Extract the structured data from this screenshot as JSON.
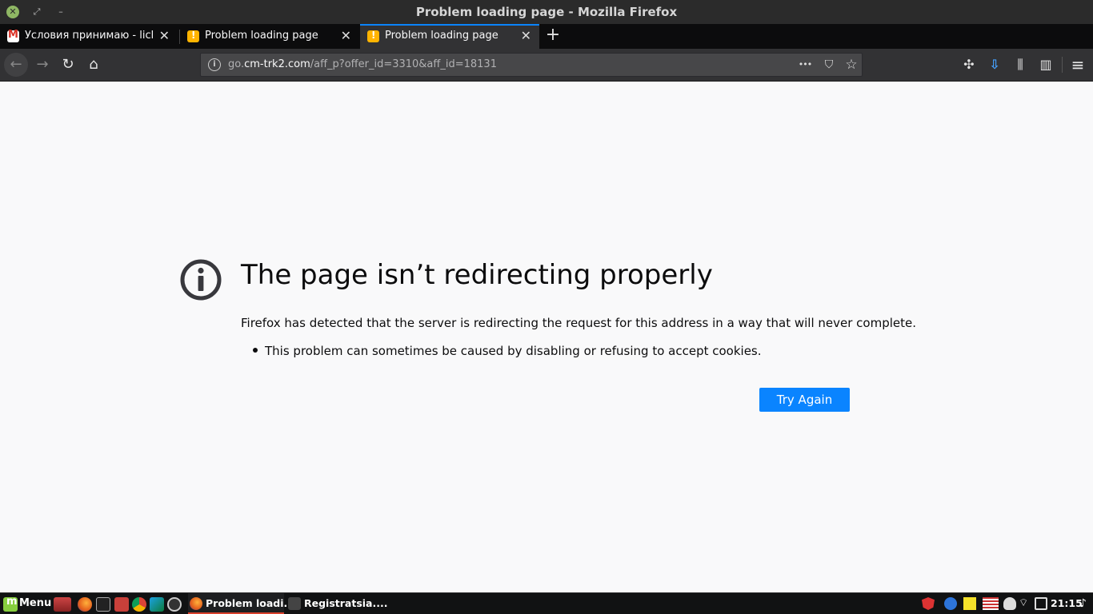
{
  "window": {
    "title": "Problem loading page - Mozilla Firefox",
    "close_glyph": "✕",
    "maximize_glyph": "⤢",
    "minimize_glyph": "–"
  },
  "tabs": [
    {
      "label": "Условия принимаю - lich.r",
      "favicon": "gmail-icon",
      "active": false
    },
    {
      "label": "Problem loading page",
      "favicon": "warning-icon",
      "active": false
    },
    {
      "label": "Problem loading page",
      "favicon": "warning-icon",
      "active": true
    }
  ],
  "tab_close_glyph": "✕",
  "new_tab_glyph": "+",
  "nav": {
    "back_glyph": "←",
    "forward_glyph": "→",
    "reload_glyph": "↻",
    "home_glyph": "⌂",
    "url_prefix": "go.",
    "url_host": "cm-trk2.com",
    "url_path": "/aff_p?offer_id=3310&aff_id=18131",
    "page_actions_glyph": "•••",
    "pocket_glyph": "⛉",
    "bookmark_glyph": "☆",
    "extensions_glyph": "✣",
    "downloads_glyph": "⇩",
    "library_glyph": "⫼",
    "sidebar_glyph": "▥",
    "menu_glyph": "≡"
  },
  "error": {
    "title": "The page isn’t redirecting properly",
    "description": "Firefox has detected that the server is redirecting the request for this address in a way that will never complete.",
    "items": [
      "This problem can sometimes be caused by disabling or refusing to accept cookies."
    ],
    "button_label": "Try Again"
  },
  "taskbar": {
    "menu_label": "Menu",
    "tasks": [
      {
        "label": "Problem loadi...",
        "icon": "firefox-icon",
        "active": true
      },
      {
        "label": "Registratsia....",
        "icon": "video-icon",
        "active": false
      }
    ],
    "clock": "21:15"
  },
  "colors": {
    "accent": "#0a84ff",
    "tab_strip": "#0c0c0d",
    "toolbar": "#323234",
    "content_bg": "#f9f9fa",
    "mint_green": "#87cf3e"
  }
}
